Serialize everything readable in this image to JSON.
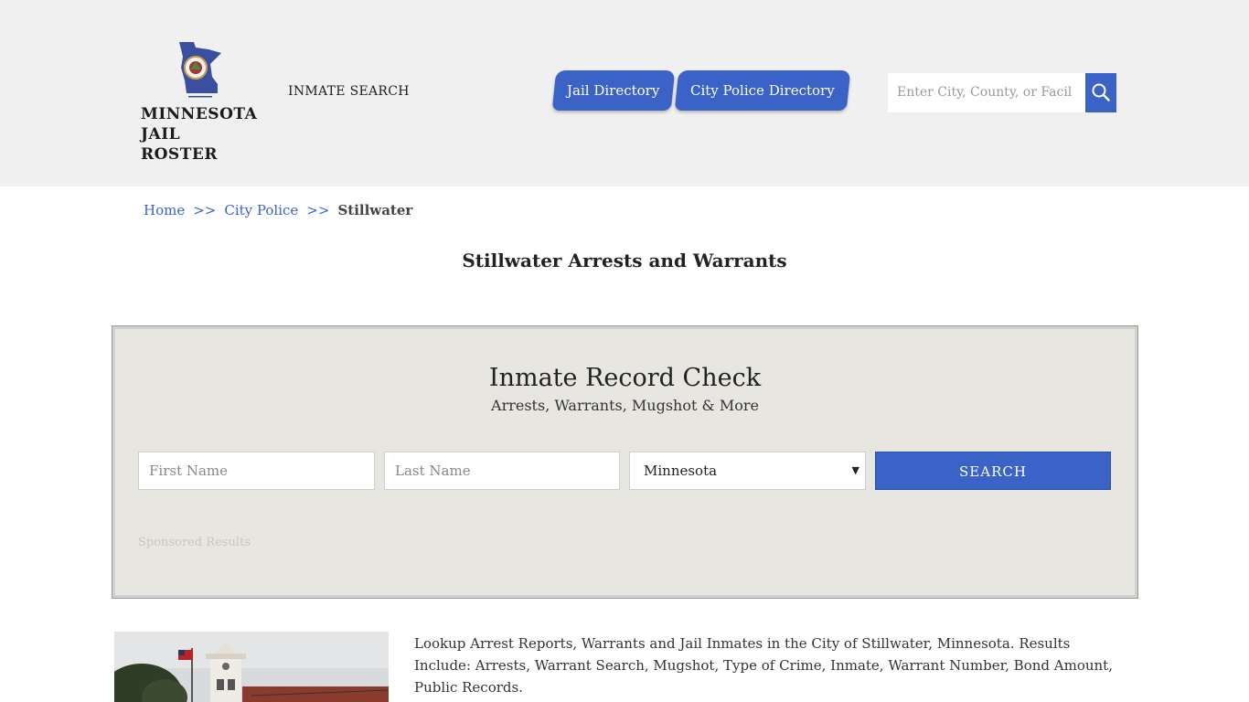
{
  "header": {
    "logo": {
      "line1": "MINNESOTA",
      "line2": "JAIL ROSTER"
    },
    "inmate_search_link": "INMATE SEARCH",
    "nav": [
      {
        "label": "Jail Directory"
      },
      {
        "label": "City Police Directory"
      }
    ],
    "search": {
      "placeholder": "Enter City, County, or Facil"
    },
    "colors": {
      "accent": "#3b63c7",
      "header_bg": "#f0f0f0"
    }
  },
  "breadcrumb": {
    "items": [
      {
        "label": "Home"
      },
      {
        "label": "City Police"
      }
    ],
    "separator": ">>",
    "current": "Stillwater"
  },
  "page_title": "Stillwater Arrests and Warrants",
  "record_check": {
    "title": "Inmate Record Check",
    "subtitle": "Arrests, Warrants, Mugshot & More",
    "first_name_placeholder": "First Name",
    "last_name_placeholder": "Last Name",
    "state_selected": "Minnesota",
    "search_label": "SEARCH",
    "sponsored_text": "Sponsored Results",
    "colors": {
      "panel_bg": "#e8e6e1"
    }
  },
  "description": "Lookup Arrest Reports, Warrants and Jail Inmates in the City of Stillwater, Minnesota. Results Include: Arrests, Warrant Search, Mugshot, Type of Crime, Inmate, Warrant Number, Bond Amount, Public Records."
}
